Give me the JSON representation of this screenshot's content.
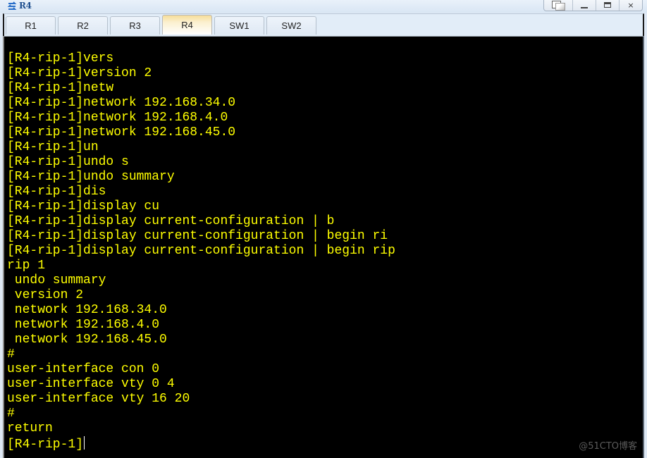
{
  "window": {
    "title": "R4",
    "controls": {
      "restore": "restore-icon",
      "minimize": "minimize-icon",
      "maximize": "maximize-icon",
      "close": "×"
    }
  },
  "tabs": [
    {
      "label": "R1",
      "active": false
    },
    {
      "label": "R2",
      "active": false
    },
    {
      "label": "R3",
      "active": false
    },
    {
      "label": "R4",
      "active": true
    },
    {
      "label": "SW1",
      "active": false
    },
    {
      "label": "SW2",
      "active": false
    }
  ],
  "terminal": {
    "text_color": "#ffff00",
    "background": "#000000",
    "lines": [
      "[R4-rip-1]vers",
      "[R4-rip-1]version 2",
      "[R4-rip-1]netw",
      "[R4-rip-1]network 192.168.34.0",
      "[R4-rip-1]network 192.168.4.0",
      "[R4-rip-1]network 192.168.45.0",
      "[R4-rip-1]un",
      "[R4-rip-1]undo s",
      "[R4-rip-1]undo summary",
      "[R4-rip-1]dis",
      "[R4-rip-1]display cu",
      "[R4-rip-1]display current-configuration | b",
      "[R4-rip-1]display current-configuration | begin ri",
      "[R4-rip-1]display current-configuration | begin rip",
      "rip 1",
      " undo summary",
      " version 2",
      " network 192.168.34.0",
      " network 192.168.4.0",
      " network 192.168.45.0",
      "#",
      "user-interface con 0",
      "user-interface vty 0 4",
      "user-interface vty 16 20",
      "#",
      "return"
    ],
    "prompt": "[R4-rip-1]"
  },
  "watermark": "@51CTO博客"
}
